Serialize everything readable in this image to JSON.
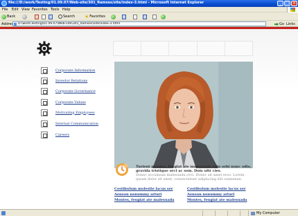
{
  "window": {
    "title": "file:///D:/work/Testing/01.09.07/Web-site/301_Ramses/site/index-3.html - Microsoft Internet Explorer",
    "minimize": "_",
    "maximize": "□",
    "close": "×"
  },
  "menu": {
    "items": [
      "File",
      "Edit",
      "View",
      "Favorites",
      "Tools",
      "Help"
    ]
  },
  "toolbar": {
    "back": "Back",
    "search": "Search",
    "favorites": "Favorites"
  },
  "address": {
    "label": "Address",
    "url": "D:\\work\\Testing\\01.09.07\\Web-site\\301_Ramses\\site\\index-3.html",
    "go": "Go",
    "links": "Links"
  },
  "page": {
    "nav": [
      {
        "label": "Corporate Information"
      },
      {
        "label": "Investor Relations"
      },
      {
        "label": "Corporate Governance"
      },
      {
        "label": "Corporate Values"
      },
      {
        "label": "Motivating Employees"
      },
      {
        "label": "Internal Communication"
      },
      {
        "label": "Careers"
      }
    ],
    "promo": {
      "title": "Turient montes, feugiat ate malesuada odio orbi nunc odio, gravida tristique orci ac sem. Duis ultr cies.",
      "text": "Donec accumsan malesuada orci. Donec sit amet eros. Lorem ipsum dolor sit amet, consectetuer adipiscing elit uismenan."
    },
    "links_left": [
      "Cestibulum molestie lacus ser",
      "Aenean nonummy arturi",
      "Montes, feugiat ate malesuada"
    ],
    "links_right": [
      "Cestibulum molestie lacus ser",
      "Aenean nonummy arturi",
      "Montes, feugiat ate malesuada"
    ]
  },
  "status": {
    "zone": "My Computer"
  },
  "colors": {
    "accent_red": "#c5201d",
    "link_blue": "#1a3c8c",
    "xp_title_blue": "#0a4ccf"
  }
}
